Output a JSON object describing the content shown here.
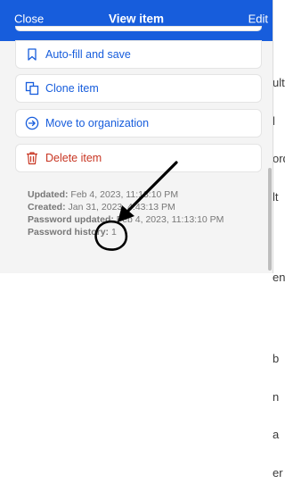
{
  "header": {
    "close_label": "Close",
    "title": "View item",
    "edit_label": "Edit"
  },
  "actions": [
    {
      "label": "Auto-fill and save",
      "icon": "bookmark-icon"
    },
    {
      "label": "Clone item",
      "icon": "copy-icon"
    },
    {
      "label": "Move to organization",
      "icon": "arrow-circle-right-icon"
    },
    {
      "label": "Delete item",
      "icon": "trash-icon"
    }
  ],
  "meta": {
    "updated_label": "Updated:",
    "updated_value": "Feb 4, 2023, 11:13:10 PM",
    "created_label": "Created:",
    "created_value": "Jan 31, 2023, 4:43:13 PM",
    "password_updated_label": "Password updated:",
    "password_updated_value": "Feb 4, 2023, 11:13:10 PM",
    "password_history_label": "Password history:",
    "password_history_value": "1"
  },
  "background_text": [
    "ult",
    "l",
    "ord",
    "lt",
    "",
    "en",
    "",
    "b",
    "n",
    "a",
    "er"
  ],
  "colors": {
    "brand": "#175ddc",
    "danger": "#c83522",
    "annotation": "#000000"
  }
}
